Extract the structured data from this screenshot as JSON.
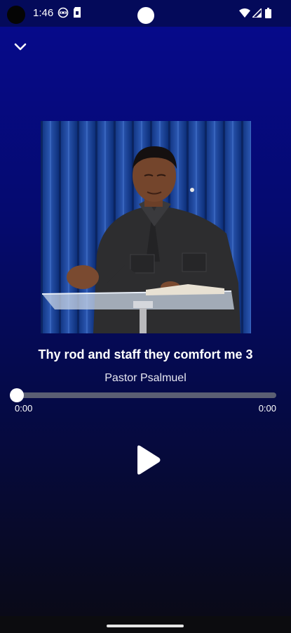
{
  "status_bar": {
    "time": "1:46",
    "icons": [
      "vpn-icon",
      "sim-card-icon",
      "wifi-icon",
      "signal-icon",
      "battery-icon"
    ]
  },
  "header": {
    "collapse_icon": "chevron-down-icon"
  },
  "player": {
    "title": "Thy rod and staff they comfort me 3",
    "artist": "Pastor Psalmuel",
    "elapsed": "0:00",
    "duration": "0:00",
    "progress": 0,
    "play_icon": "play-icon"
  },
  "colors": {
    "background_top": "#060a8e",
    "background_bottom": "#0a0a14",
    "progress_track": "#5b5f73",
    "progress_thumb": "#ffffff"
  }
}
